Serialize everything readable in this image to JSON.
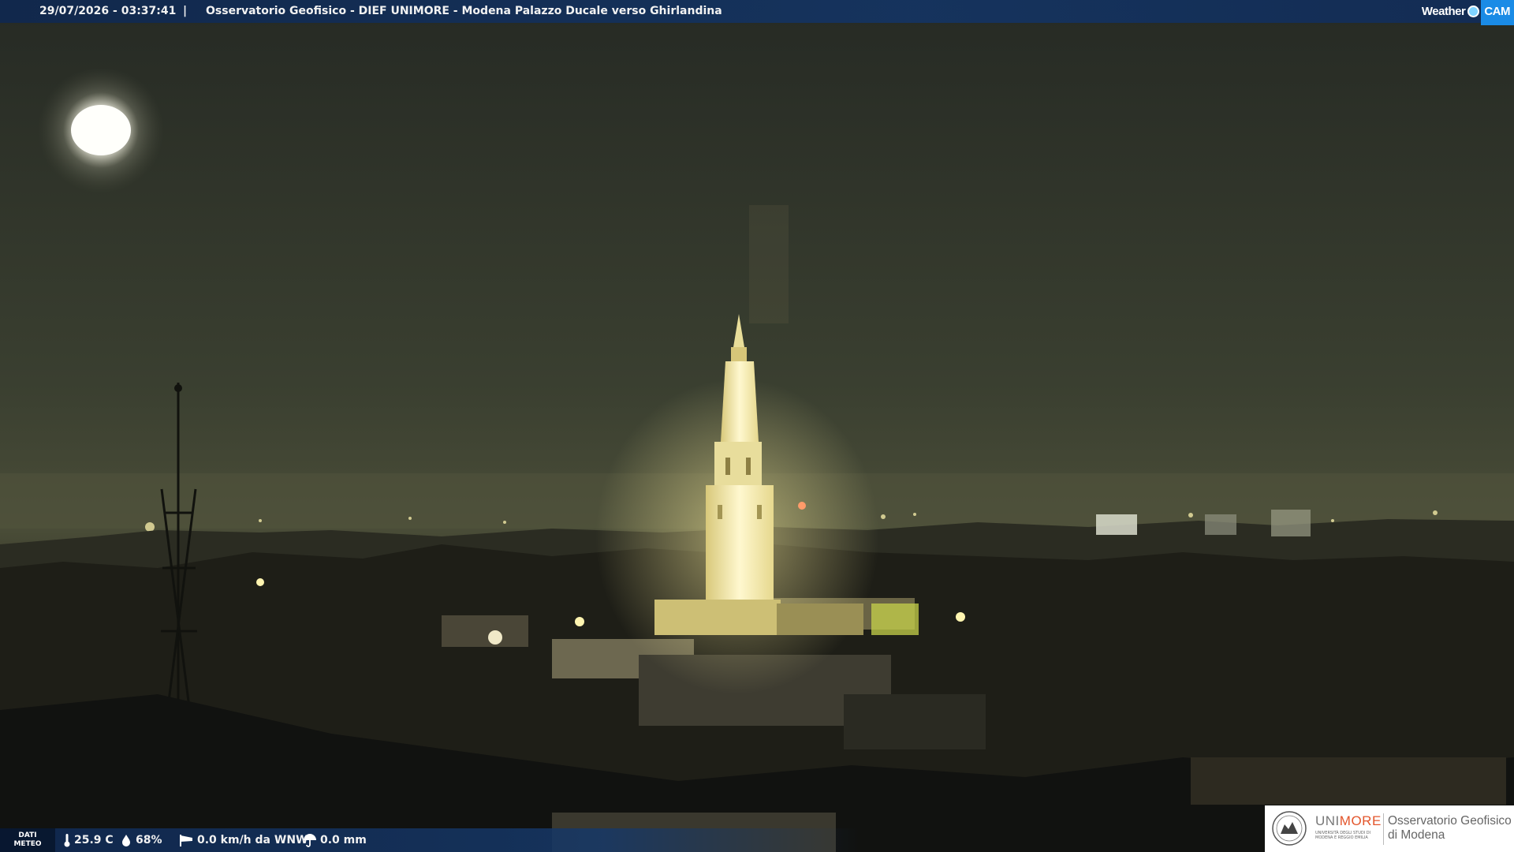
{
  "top_bar": {
    "timestamp": "29/07/2026 - 03:37:41",
    "separator": "|",
    "camera_title": "Osservatorio Geofisico - DIEF UNIMORE - Modena Palazzo Ducale verso Ghirlandina"
  },
  "brand": {
    "word_weather": "Weather",
    "word_cam": "CAM",
    "icon": "globe-dot-icon"
  },
  "meteo_bar": {
    "label_line1": "DATI",
    "label_line2": "METEO",
    "temperature": "25.9 C",
    "humidity": "68%",
    "wind": "0.0 km/h da WNW",
    "rain": "0.0 mm",
    "icons": [
      "thermometer-icon",
      "humidity-drop-icon",
      "windsock-icon",
      "umbrella-icon"
    ]
  },
  "logo": {
    "unimore_prefix": "UNI",
    "unimore_suffix": "MORE",
    "unimore_sub": "UNIVERSITÀ DEGLI STUDI DI MODENA E REGGIO EMILIA",
    "observatory_line1": "Osservatorio Geofisico",
    "observatory_line2": "di Modena"
  },
  "colors": {
    "bar_blue": "#14346a",
    "unimore_orange": "#e3552b",
    "cam_blue": "#1a8be6"
  }
}
